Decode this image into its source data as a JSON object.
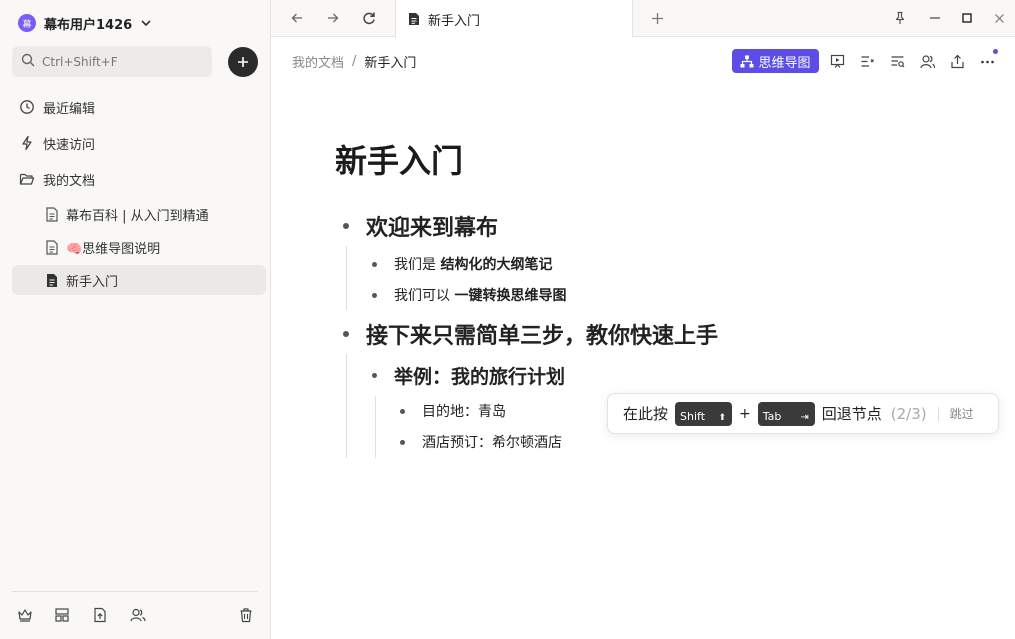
{
  "sidebar": {
    "user_name": "幕布用户1426",
    "avatar_text": "幕",
    "search_placeholder": "Ctrl+Shift+F",
    "nav": {
      "recent": "最近编辑",
      "quick": "快速访问",
      "my_docs": "我的文档"
    },
    "docs": [
      {
        "label": "幕布百科 | 从入门到精通"
      },
      {
        "label": "🧠思维导图说明"
      },
      {
        "label": "新手入门"
      }
    ]
  },
  "tabbar": {
    "tab_title": "新手入门"
  },
  "header": {
    "breadcrumb_root": "我的文档",
    "breadcrumb_sep": "/",
    "breadcrumb_current": "新手入门",
    "mindmap_label": "思维导图"
  },
  "document": {
    "title": "新手入门",
    "sec1_title": "欢迎来到幕布",
    "sec1_item1_prefix": "我们是",
    "sec1_item1_bold": "结构化的大纲笔记",
    "sec1_item2_prefix": "我们可以",
    "sec1_item2_bold": "一键转换思维导图",
    "sec2_title": "接下来只需简单三步，教你快速上手",
    "sec2_sub_title": "举例：我的旅行计划",
    "sec2_sub_item1": "目的地：青岛",
    "sec2_sub_item2": "酒店预订：希尔顿酒店"
  },
  "tooltip": {
    "prefix": "在此按",
    "key_shift": "Shift",
    "key_shift_glyph": "⬆",
    "plus": "+",
    "key_tab": "Tab",
    "key_tab_glyph": "⇥",
    "suffix": "回退节点",
    "step": "(2/3)",
    "skip": "跳过"
  },
  "colors": {
    "accent": "#5b4de6",
    "avatar": "#7b5cf5",
    "sidebar_bg": "#f9f8f7"
  }
}
